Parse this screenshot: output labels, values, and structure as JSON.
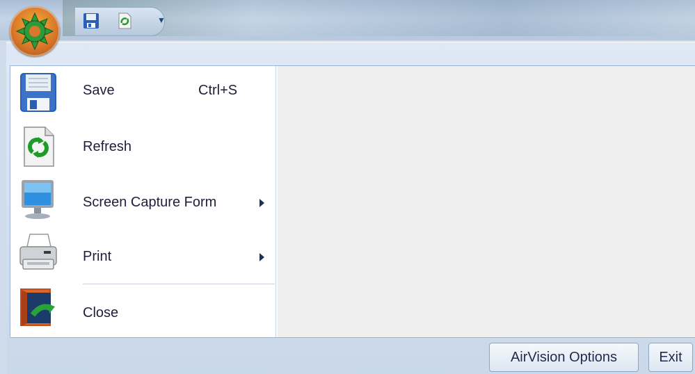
{
  "menu": {
    "items": [
      {
        "label": "Save",
        "shortcut": "Ctrl+S",
        "icon": "floppy-disk-icon"
      },
      {
        "label": "Refresh",
        "icon": "refresh-document-icon"
      },
      {
        "label": "Screen Capture Form",
        "icon": "monitor-icon",
        "has_submenu": true
      },
      {
        "label": "Print",
        "icon": "printer-icon",
        "has_submenu": true
      },
      {
        "label": "Close",
        "icon": "exit-door-icon"
      }
    ]
  },
  "footer": {
    "options_label": "AirVision Options",
    "exit_label": "Exit"
  },
  "colors": {
    "orb": "#e0842c",
    "orb_gear": "#2f9a3a",
    "menu_text": "#1e1e3c",
    "right_pane": "#efefef"
  }
}
